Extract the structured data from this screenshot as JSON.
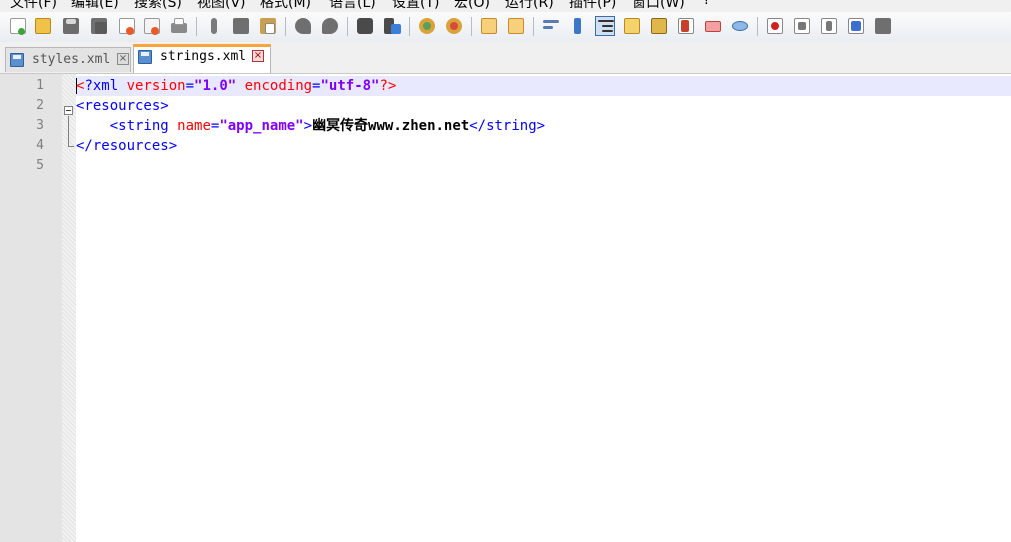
{
  "menu": [
    "文件(F)",
    "编辑(E)",
    "搜索(S)",
    "视图(V)",
    "格式(M)",
    "语言(L)",
    "设置(T)",
    "宏(O)",
    "运行(R)",
    "插件(P)",
    "窗口(W)",
    "?"
  ],
  "toolbar": {
    "icons": [
      "new-file-icon",
      "open-icon",
      "save-icon",
      "save-all-icon",
      "close-icon",
      "close-all-icon",
      "print-icon",
      "cut-icon",
      "copy-icon",
      "paste-icon",
      "undo-icon",
      "redo-icon",
      "find-icon",
      "replace-icon",
      "zoom-in-icon",
      "zoom-out-icon",
      "sync-vertical-icon",
      "sync-horizontal-icon",
      "word-wrap-icon",
      "show-all-chars-icon",
      "indent-guide-icon",
      "user-lang-icon",
      "doc-map-icon",
      "function-list-icon",
      "folder-workspace-icon",
      "monitoring-icon",
      "record-macro-icon",
      "stop-macro-icon",
      "play-macro-icon",
      "run-macro-multiple-icon",
      "save-macro-icon"
    ]
  },
  "tabs": [
    {
      "label": "styles.xml",
      "active": false
    },
    {
      "label": "strings.xml",
      "active": true
    }
  ],
  "editor": {
    "line_numbers": [
      "1",
      "2",
      "3",
      "4",
      "5"
    ],
    "line1": {
      "open": "<",
      "prolog": "?xml",
      "attr1": " version",
      "eq1": "=",
      "val1": "\"1.0\"",
      "attr2": " encoding",
      "eq2": "=",
      "val2": "\"utf-8\"",
      "close": "?>"
    },
    "line2": {
      "tag": "<resources>"
    },
    "line3": {
      "indent": "    ",
      "open": "<string",
      "attr": " name",
      "eq": "=",
      "val": "\"app_name\"",
      "gt": ">",
      "text": "幽冥传奇www.zhen.net",
      "close": "</string>"
    },
    "line4": {
      "tag": "</resources>"
    }
  },
  "colors": {
    "accent_tab": "#f9a43a",
    "current_line": "#e8e8ff",
    "tag": "#0000ff",
    "attribute": "#ff0000",
    "value": "#8000ff"
  }
}
